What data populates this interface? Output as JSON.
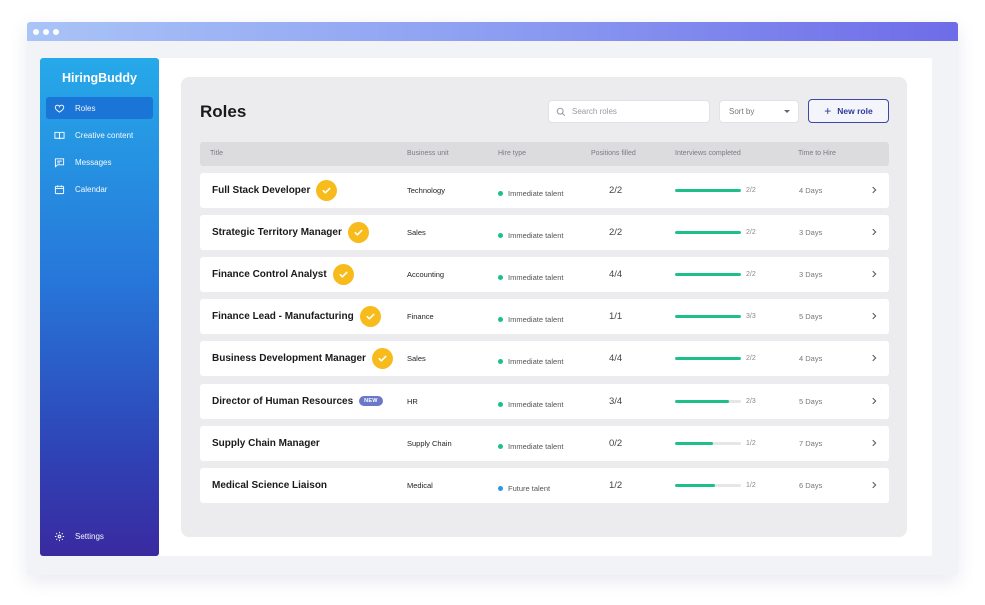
{
  "app": {
    "brand": "HiringBuddy"
  },
  "sidebar": {
    "items": [
      {
        "label": "Roles",
        "icon": "heart-icon",
        "active": true
      },
      {
        "label": "Creative content",
        "icon": "book-icon",
        "active": false
      },
      {
        "label": "Messages",
        "icon": "message-icon",
        "active": false
      },
      {
        "label": "Calendar",
        "icon": "calendar-icon",
        "active": false
      }
    ],
    "settings_label": "Settings"
  },
  "page": {
    "title": "Roles"
  },
  "toolbar": {
    "search_placeholder": "Search roles",
    "sort_label": "Sort by",
    "new_role_label": "New role"
  },
  "table": {
    "headers": [
      "Title",
      "Business unit",
      "Hire type",
      "Positions filled",
      "Interviews completed",
      "Time to Hire"
    ],
    "rows": [
      {
        "title": "Full Stack Developer",
        "business_unit": "Technology",
        "hire_type": "Immediate talent",
        "positions": "2/2",
        "interviews": "2/2",
        "interview_fraction": 1.0,
        "time_to_hire": "4 Days",
        "checked": true,
        "badge": ""
      },
      {
        "title": "Strategic Territory Manager",
        "business_unit": "Sales",
        "hire_type": "Immediate talent",
        "positions": "2/2",
        "interviews": "2/2",
        "interview_fraction": 1.0,
        "time_to_hire": "3 Days",
        "checked": true,
        "badge": ""
      },
      {
        "title": "Finance Control Analyst",
        "business_unit": "Accounting",
        "hire_type": "Immediate talent",
        "positions": "4/4",
        "interviews": "2/2",
        "interview_fraction": 1.0,
        "time_to_hire": "3 Days",
        "checked": true,
        "badge": ""
      },
      {
        "title": "Finance Lead - Manufacturing",
        "business_unit": "Finance",
        "hire_type": "Immediate talent",
        "positions": "1/1",
        "interviews": "3/3",
        "interview_fraction": 1.0,
        "time_to_hire": "5 Days",
        "checked": true,
        "badge": ""
      },
      {
        "title": "Business Development Manager",
        "business_unit": "Sales",
        "hire_type": "Immediate talent",
        "positions": "4/4",
        "interviews": "2/2",
        "interview_fraction": 1.0,
        "time_to_hire": "4 Days",
        "checked": true,
        "badge": ""
      },
      {
        "title": "Director of Human Resources",
        "business_unit": "HR",
        "hire_type": "Immediate talent",
        "positions": "3/4",
        "interviews": "2/3",
        "interview_fraction": 0.82,
        "time_to_hire": "5 Days",
        "checked": false,
        "badge": "NEW"
      },
      {
        "title": "Supply Chain Manager",
        "business_unit": "Supply Chain",
        "hire_type": "Immediate talent",
        "positions": "0/2",
        "interviews": "1/2",
        "interview_fraction": 0.58,
        "time_to_hire": "7 Days",
        "checked": false,
        "badge": ""
      },
      {
        "title": "Medical Science Liaison",
        "business_unit": "Medical",
        "hire_type": "Future talent",
        "positions": "1/2",
        "interviews": "1/2",
        "interview_fraction": 0.6,
        "time_to_hire": "6 Days",
        "checked": false,
        "badge": ""
      }
    ]
  },
  "colors": {
    "immediate": "#1dbf8a",
    "future": "#2a9ae8",
    "check": "#f8bb1c",
    "accent": "#3d47a8"
  }
}
